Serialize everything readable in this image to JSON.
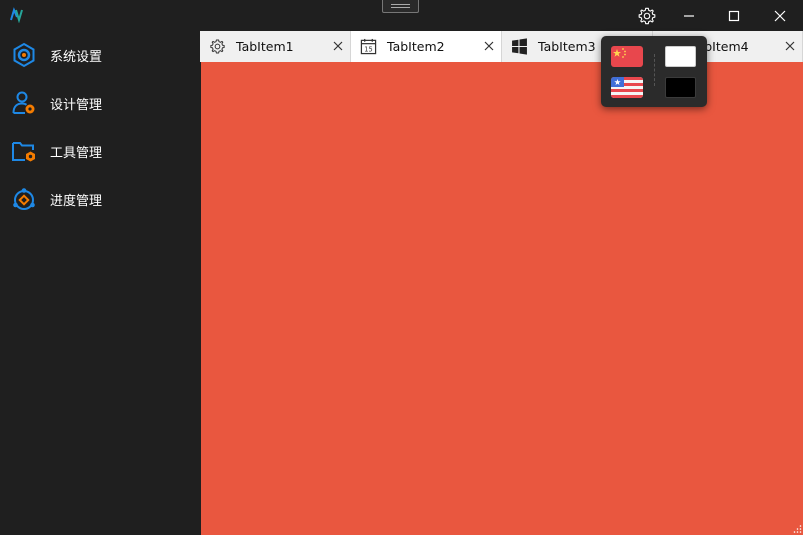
{
  "titlebar": {
    "settings_icon": "gear-icon",
    "minimize_icon": "minimize-icon",
    "maximize_icon": "maximize-icon",
    "close_icon": "close-icon"
  },
  "sidebar": {
    "items": [
      {
        "label": "系统设置",
        "icon": "system-settings-icon"
      },
      {
        "label": "设计管理",
        "icon": "user-design-icon"
      },
      {
        "label": "工具管理",
        "icon": "folder-tool-icon"
      },
      {
        "label": "进度管理",
        "icon": "progress-icon"
      }
    ],
    "icon_accent": "#1e88e5",
    "icon_secondary": "#f57c00"
  },
  "tabs": [
    {
      "label": "TabItem1",
      "icon": "gear-icon",
      "active": false
    },
    {
      "label": "TabItem2",
      "icon": "calendar-icon",
      "calendar_day": "15",
      "active": true
    },
    {
      "label": "TabItem3",
      "icon": "windows-icon",
      "active": false
    },
    {
      "label": "TabItem4",
      "icon": "",
      "active": false
    }
  ],
  "content": {
    "background": "#e9573f"
  },
  "popup": {
    "languages": [
      {
        "name": "chinese-flag-icon"
      },
      {
        "name": "us-flag-icon"
      }
    ],
    "themes": [
      {
        "name": "light-theme-swatch",
        "color": "#ffffff"
      },
      {
        "name": "dark-theme-swatch",
        "color": "#000000"
      }
    ]
  }
}
